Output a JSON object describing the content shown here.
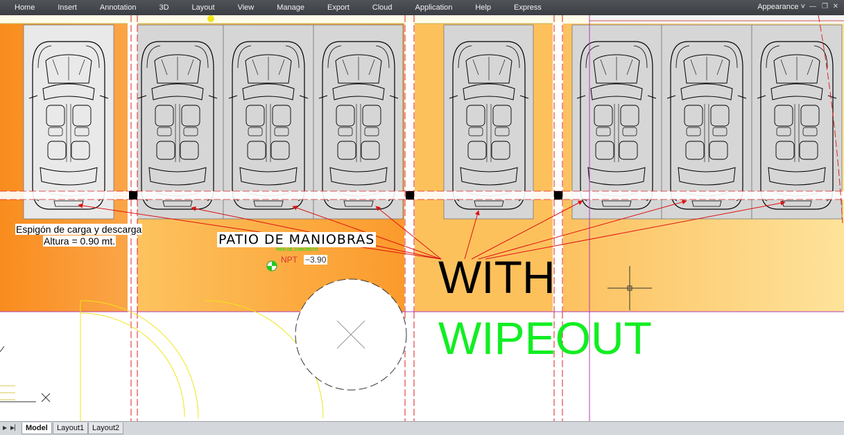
{
  "menu": [
    "Home",
    "Insert",
    "Annotation",
    "3D",
    "Layout",
    "View",
    "Manage",
    "Export",
    "Cloud",
    "Application",
    "Help",
    "Express"
  ],
  "appearance": "Appearance",
  "labels": {
    "spigot_line1": "Espigón de carga y descarga",
    "spigot_line2": "Altura = 0.90 mt.",
    "patio": "PATIO DE MANIOBRAS",
    "piso": "PISO DE CONCRETO",
    "npt_label": "NPT",
    "npt_value": "−3.90",
    "with": "WITH",
    "wipeout": "WIPEOUT"
  },
  "tabs": [
    {
      "label": "Model",
      "active": true
    },
    {
      "label": "Layout1",
      "active": false
    },
    {
      "label": "Layout2",
      "active": false
    }
  ],
  "colors": {
    "menubar": "#45484c",
    "floor_orange": "#fb9a2c",
    "floor_light": "#fdd57c",
    "parking_bay": "#d5d5d5",
    "arrow": "#dd1111",
    "wipeout_text": "#11ee22"
  }
}
